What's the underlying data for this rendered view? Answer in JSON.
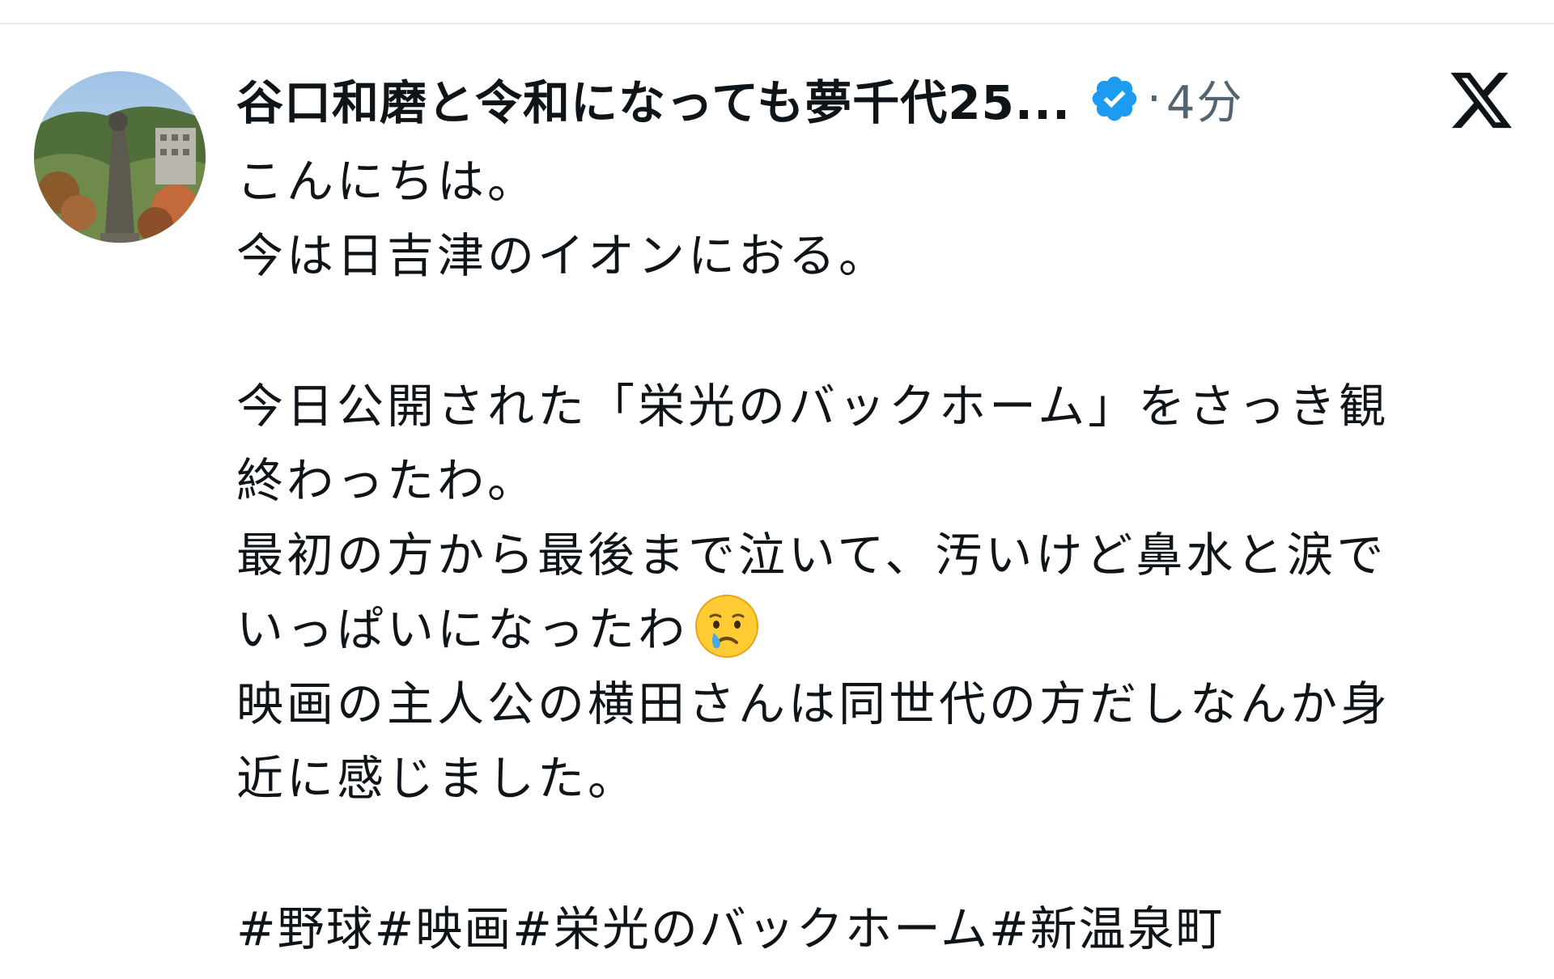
{
  "tweet": {
    "author": {
      "display_name": "谷口和磨と令和になっても夢千代25...",
      "verified": true,
      "avatar_icon": "avatar-statue-photo"
    },
    "separator": "·",
    "time_ago": "4分",
    "platform_logo": "x-logo-icon",
    "lines": [
      "こんにちは。",
      "今は日吉津のイオンにおる。",
      "",
      "今日公開された「栄光のバックホーム」をさっき観",
      "終わったわ。",
      "最初の方から最後まで泣いて、汚いけど鼻水と涙で",
      "いっぱいになったわ",
      "映画の主人公の横田さんは同世代の方だしなんか身",
      "近に感じました。",
      ""
    ],
    "emoji": "crying-face-icon",
    "hashtags": [
      "#野球",
      "#映画",
      "#栄光のバックホーム",
      "#新温泉町"
    ]
  },
  "colors": {
    "text": "#0f1419",
    "secondary": "#536471",
    "verified_badge": "#1d9bf0",
    "divider": "#e6e9ec"
  }
}
